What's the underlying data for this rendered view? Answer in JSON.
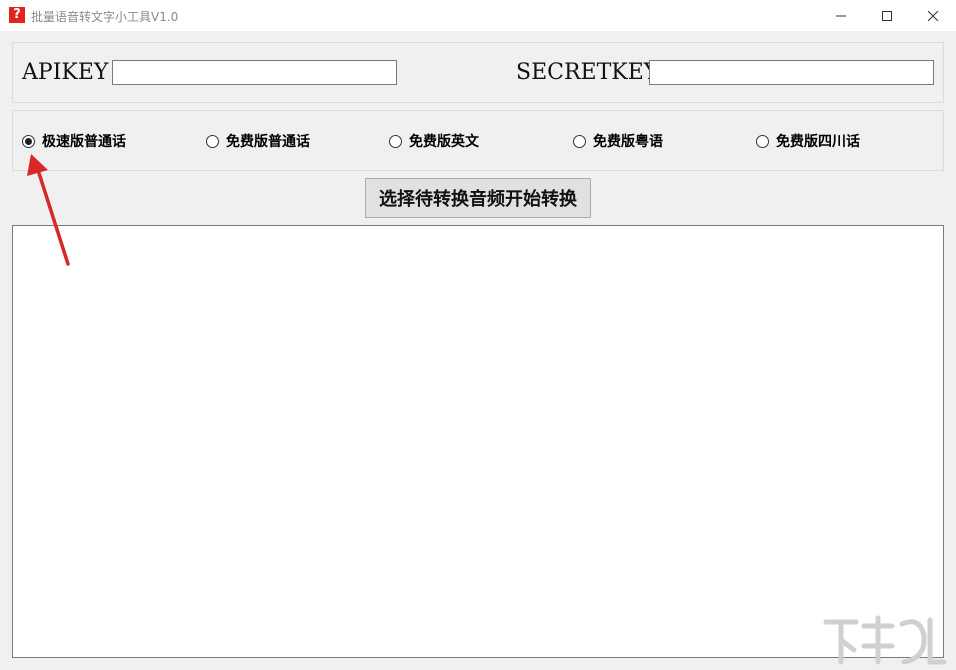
{
  "window": {
    "title": "批量语音转文字小工具V1.0",
    "icon": "question-mark-icon",
    "icon_glyph": "?",
    "icon_color": "#e0261c",
    "controls": [
      "minimize-icon",
      "maximize-icon",
      "close-icon"
    ]
  },
  "credentials": {
    "apikey_label": "APIKEY",
    "apikey_value": "",
    "secretkey_label": "SECRETKEY",
    "secretkey_value": ""
  },
  "modes": [
    {
      "label": "极速版普通话",
      "selected": true
    },
    {
      "label": "免费版普通话",
      "selected": false
    },
    {
      "label": "免费版英文",
      "selected": false
    },
    {
      "label": "免费版粤语",
      "selected": false
    },
    {
      "label": "免费版四川话",
      "selected": false
    }
  ],
  "convert_button_label": "选择待转换音频开始转换",
  "output_text": "",
  "annotation": {
    "arrow_color": "#d62828"
  }
}
